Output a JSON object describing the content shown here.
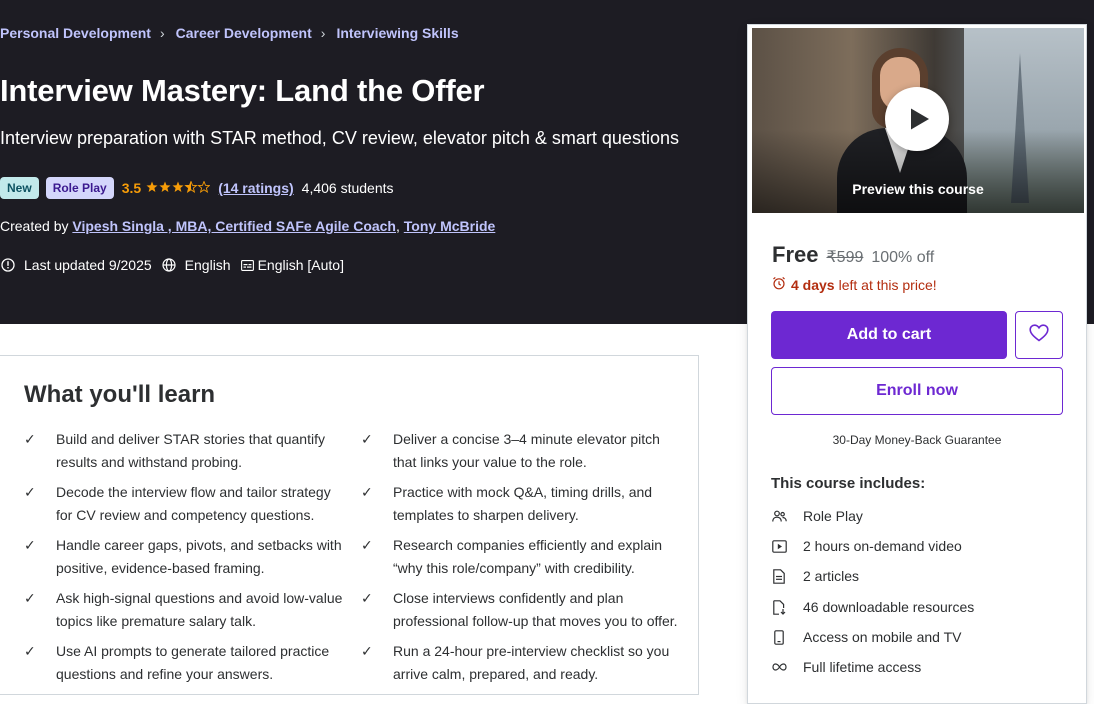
{
  "breadcrumb": [
    "Personal Development",
    "Career Development",
    "Interviewing Skills"
  ],
  "course": {
    "title": "Interview Mastery: Land the Offer",
    "subtitle": "Interview preparation with STAR method, CV review, elevator pitch & smart questions",
    "badges": [
      "New",
      "Role Play"
    ],
    "rating": "3.5",
    "rating_stars": 3.5,
    "ratings_count": "(14 ratings)",
    "students": "4,406 students",
    "created_by_label": "Created by",
    "instructor_1": "Vipesh Singla , MBA, Certified SAFe Agile Coach",
    "instructor_sep": ",",
    "instructor_2": "Tony McBride",
    "last_updated": "Last updated 9/2025",
    "language": "English",
    "captions": "English [Auto]"
  },
  "learn": {
    "title": "What you'll learn",
    "items": [
      "Build and deliver STAR stories that quantify results and withstand probing.",
      "Deliver a concise 3–4 minute elevator pitch that links your value to the role.",
      "Decode the interview flow and tailor strategy for CV review and competency questions.",
      "Practice with mock Q&A, timing drills, and templates to sharpen delivery.",
      "Handle career gaps, pivots, and setbacks with positive, evidence-based framing.",
      "Research companies efficiently and explain “why this role/company” with credibility.",
      "Ask high-signal questions and avoid low-value topics like premature salary talk.",
      "Close interviews confidently and plan professional follow-up that moves you to offer.",
      "Use AI prompts to generate tailored practice questions and refine your answers.",
      "Run a 24-hour pre-interview checklist so you arrive calm, prepared, and ready."
    ]
  },
  "sidebar": {
    "preview_label": "Preview this course",
    "price": "Free",
    "original_price": "₹599",
    "discount": "100% off",
    "timer_days": "4 days",
    "timer_suffix": "left at this price!",
    "add_to_cart": "Add to cart",
    "enroll_now": "Enroll now",
    "guarantee": "30-Day Money-Back Guarantee",
    "includes_title": "This course includes:",
    "includes": [
      {
        "icon": "role-play-icon",
        "label": "Role Play"
      },
      {
        "icon": "video-icon",
        "label": "2 hours on-demand video"
      },
      {
        "icon": "article-icon",
        "label": "2 articles"
      },
      {
        "icon": "download-icon",
        "label": "46 downloadable resources"
      },
      {
        "icon": "mobile-icon",
        "label": "Access on mobile and TV"
      },
      {
        "icon": "infinity-icon",
        "label": "Full lifetime access"
      }
    ]
  },
  "colors": {
    "hero_bg": "#1d1c23",
    "link": "#c0c4fc",
    "star": "#f69c08",
    "brand": "#6d28d2",
    "timer": "#b32d0f"
  }
}
